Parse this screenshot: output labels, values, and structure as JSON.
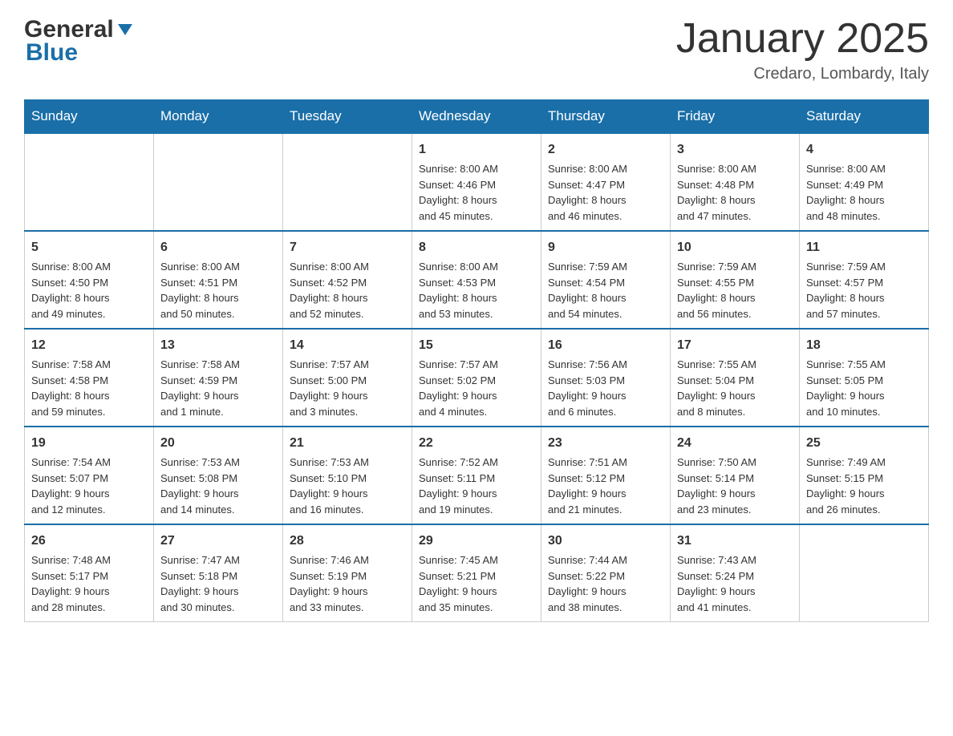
{
  "header": {
    "logo_text1": "General",
    "logo_text2": "Blue",
    "month_title": "January 2025",
    "location": "Credaro, Lombardy, Italy"
  },
  "days_of_week": [
    "Sunday",
    "Monday",
    "Tuesday",
    "Wednesday",
    "Thursday",
    "Friday",
    "Saturday"
  ],
  "weeks": [
    [
      {
        "day": "",
        "info": ""
      },
      {
        "day": "",
        "info": ""
      },
      {
        "day": "",
        "info": ""
      },
      {
        "day": "1",
        "info": "Sunrise: 8:00 AM\nSunset: 4:46 PM\nDaylight: 8 hours\nand 45 minutes."
      },
      {
        "day": "2",
        "info": "Sunrise: 8:00 AM\nSunset: 4:47 PM\nDaylight: 8 hours\nand 46 minutes."
      },
      {
        "day": "3",
        "info": "Sunrise: 8:00 AM\nSunset: 4:48 PM\nDaylight: 8 hours\nand 47 minutes."
      },
      {
        "day": "4",
        "info": "Sunrise: 8:00 AM\nSunset: 4:49 PM\nDaylight: 8 hours\nand 48 minutes."
      }
    ],
    [
      {
        "day": "5",
        "info": "Sunrise: 8:00 AM\nSunset: 4:50 PM\nDaylight: 8 hours\nand 49 minutes."
      },
      {
        "day": "6",
        "info": "Sunrise: 8:00 AM\nSunset: 4:51 PM\nDaylight: 8 hours\nand 50 minutes."
      },
      {
        "day": "7",
        "info": "Sunrise: 8:00 AM\nSunset: 4:52 PM\nDaylight: 8 hours\nand 52 minutes."
      },
      {
        "day": "8",
        "info": "Sunrise: 8:00 AM\nSunset: 4:53 PM\nDaylight: 8 hours\nand 53 minutes."
      },
      {
        "day": "9",
        "info": "Sunrise: 7:59 AM\nSunset: 4:54 PM\nDaylight: 8 hours\nand 54 minutes."
      },
      {
        "day": "10",
        "info": "Sunrise: 7:59 AM\nSunset: 4:55 PM\nDaylight: 8 hours\nand 56 minutes."
      },
      {
        "day": "11",
        "info": "Sunrise: 7:59 AM\nSunset: 4:57 PM\nDaylight: 8 hours\nand 57 minutes."
      }
    ],
    [
      {
        "day": "12",
        "info": "Sunrise: 7:58 AM\nSunset: 4:58 PM\nDaylight: 8 hours\nand 59 minutes."
      },
      {
        "day": "13",
        "info": "Sunrise: 7:58 AM\nSunset: 4:59 PM\nDaylight: 9 hours\nand 1 minute."
      },
      {
        "day": "14",
        "info": "Sunrise: 7:57 AM\nSunset: 5:00 PM\nDaylight: 9 hours\nand 3 minutes."
      },
      {
        "day": "15",
        "info": "Sunrise: 7:57 AM\nSunset: 5:02 PM\nDaylight: 9 hours\nand 4 minutes."
      },
      {
        "day": "16",
        "info": "Sunrise: 7:56 AM\nSunset: 5:03 PM\nDaylight: 9 hours\nand 6 minutes."
      },
      {
        "day": "17",
        "info": "Sunrise: 7:55 AM\nSunset: 5:04 PM\nDaylight: 9 hours\nand 8 minutes."
      },
      {
        "day": "18",
        "info": "Sunrise: 7:55 AM\nSunset: 5:05 PM\nDaylight: 9 hours\nand 10 minutes."
      }
    ],
    [
      {
        "day": "19",
        "info": "Sunrise: 7:54 AM\nSunset: 5:07 PM\nDaylight: 9 hours\nand 12 minutes."
      },
      {
        "day": "20",
        "info": "Sunrise: 7:53 AM\nSunset: 5:08 PM\nDaylight: 9 hours\nand 14 minutes."
      },
      {
        "day": "21",
        "info": "Sunrise: 7:53 AM\nSunset: 5:10 PM\nDaylight: 9 hours\nand 16 minutes."
      },
      {
        "day": "22",
        "info": "Sunrise: 7:52 AM\nSunset: 5:11 PM\nDaylight: 9 hours\nand 19 minutes."
      },
      {
        "day": "23",
        "info": "Sunrise: 7:51 AM\nSunset: 5:12 PM\nDaylight: 9 hours\nand 21 minutes."
      },
      {
        "day": "24",
        "info": "Sunrise: 7:50 AM\nSunset: 5:14 PM\nDaylight: 9 hours\nand 23 minutes."
      },
      {
        "day": "25",
        "info": "Sunrise: 7:49 AM\nSunset: 5:15 PM\nDaylight: 9 hours\nand 26 minutes."
      }
    ],
    [
      {
        "day": "26",
        "info": "Sunrise: 7:48 AM\nSunset: 5:17 PM\nDaylight: 9 hours\nand 28 minutes."
      },
      {
        "day": "27",
        "info": "Sunrise: 7:47 AM\nSunset: 5:18 PM\nDaylight: 9 hours\nand 30 minutes."
      },
      {
        "day": "28",
        "info": "Sunrise: 7:46 AM\nSunset: 5:19 PM\nDaylight: 9 hours\nand 33 minutes."
      },
      {
        "day": "29",
        "info": "Sunrise: 7:45 AM\nSunset: 5:21 PM\nDaylight: 9 hours\nand 35 minutes."
      },
      {
        "day": "30",
        "info": "Sunrise: 7:44 AM\nSunset: 5:22 PM\nDaylight: 9 hours\nand 38 minutes."
      },
      {
        "day": "31",
        "info": "Sunrise: 7:43 AM\nSunset: 5:24 PM\nDaylight: 9 hours\nand 41 minutes."
      },
      {
        "day": "",
        "info": ""
      }
    ]
  ]
}
